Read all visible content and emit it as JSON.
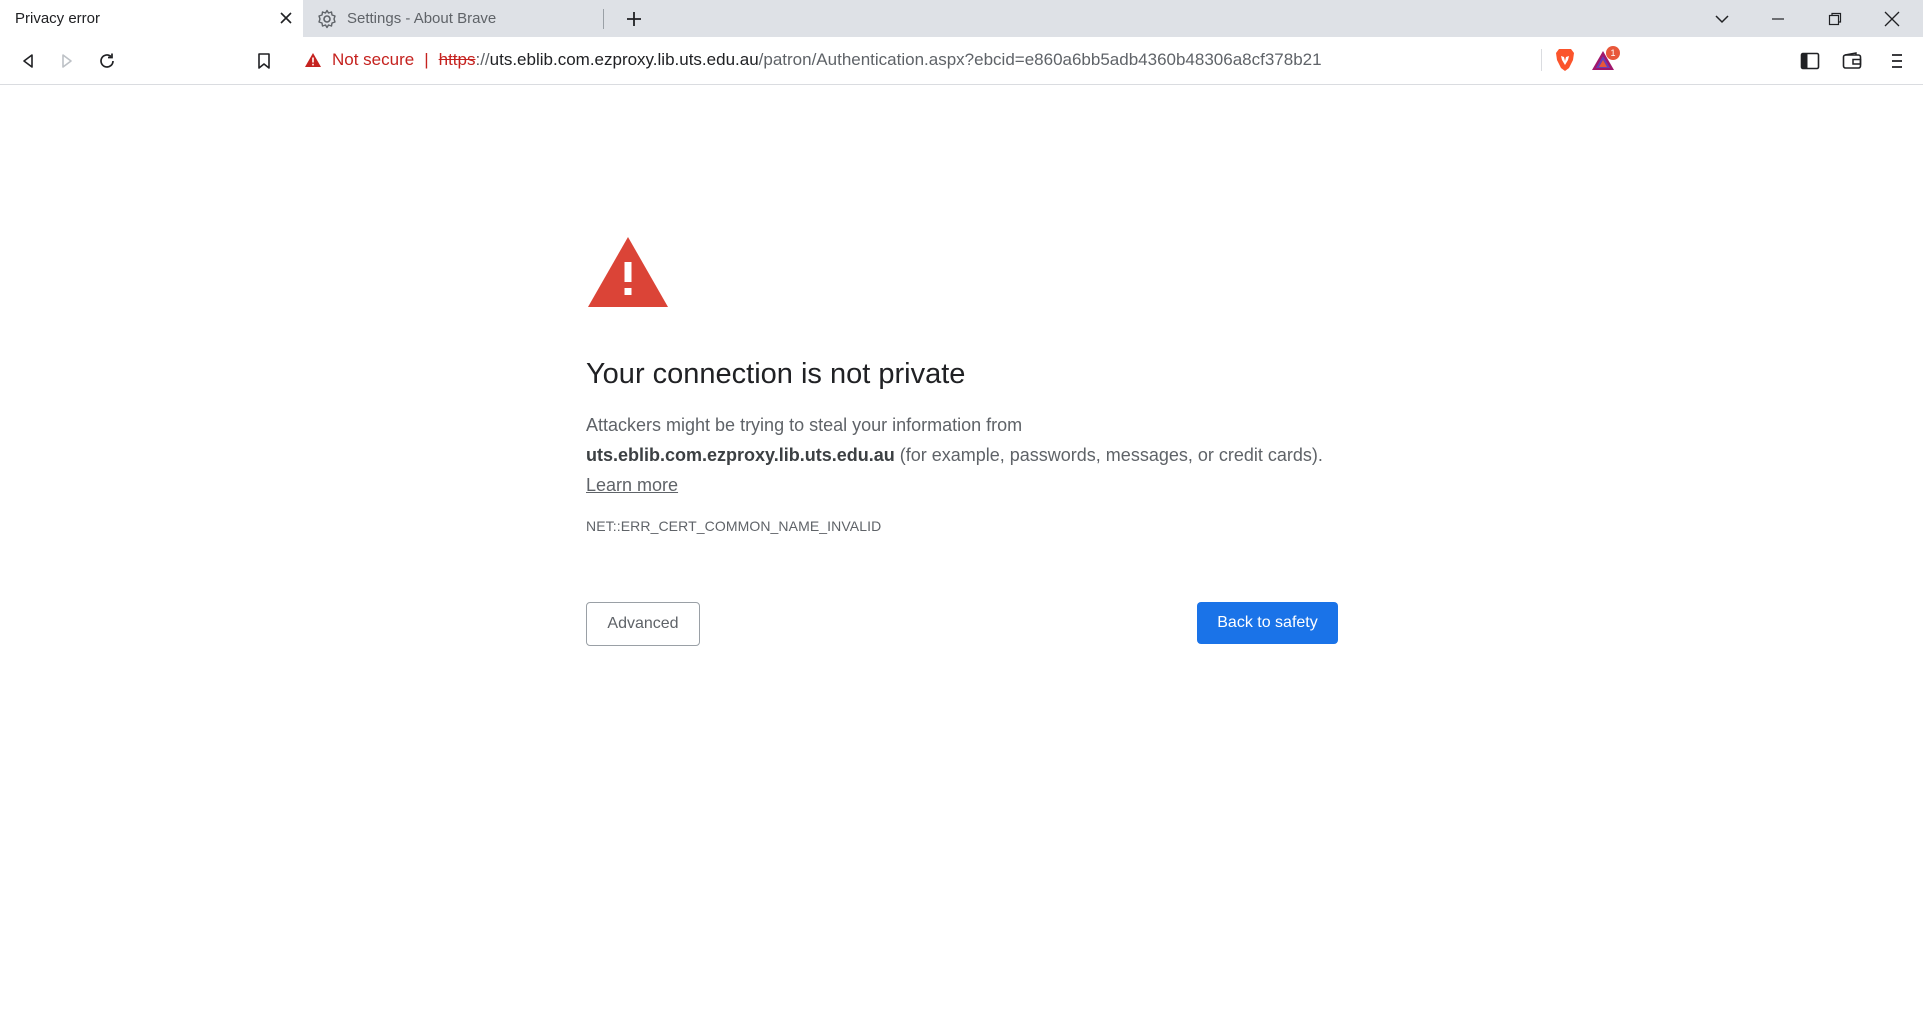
{
  "tabs": [
    {
      "title": "Privacy error",
      "active": true
    },
    {
      "title": "Settings - About Brave",
      "active": false
    }
  ],
  "toolbar": {
    "security_label": "Not secure",
    "separator": "|",
    "url_scheme": "https",
    "url_colon": "://",
    "url_host": "uts.eblib.com.ezproxy.lib.uts.edu.au",
    "url_path": "/patron/Authentication.aspx?ebcid=e860a6bb5adb4360b48306a8cf378b21",
    "rewards_badge": "1"
  },
  "interstitial": {
    "heading": "Your connection is not private",
    "explain_prefix": "Attackers might be trying to steal your information from",
    "site": "uts.eblib.com.ezproxy.lib.uts.edu.au",
    "explain_suffix": "(for example, passwords, messages, or credit cards).",
    "learn_more": "Learn more",
    "error_code": "NET::ERR_CERT_COMMON_NAME_INVALID",
    "advanced_label": "Advanced",
    "back_label": "Back to safety"
  },
  "colors": {
    "danger": "#c5221f",
    "warning_icon": "#db4437",
    "primary_button": "#1a73e8",
    "tabstrip": "#dee1e6"
  }
}
